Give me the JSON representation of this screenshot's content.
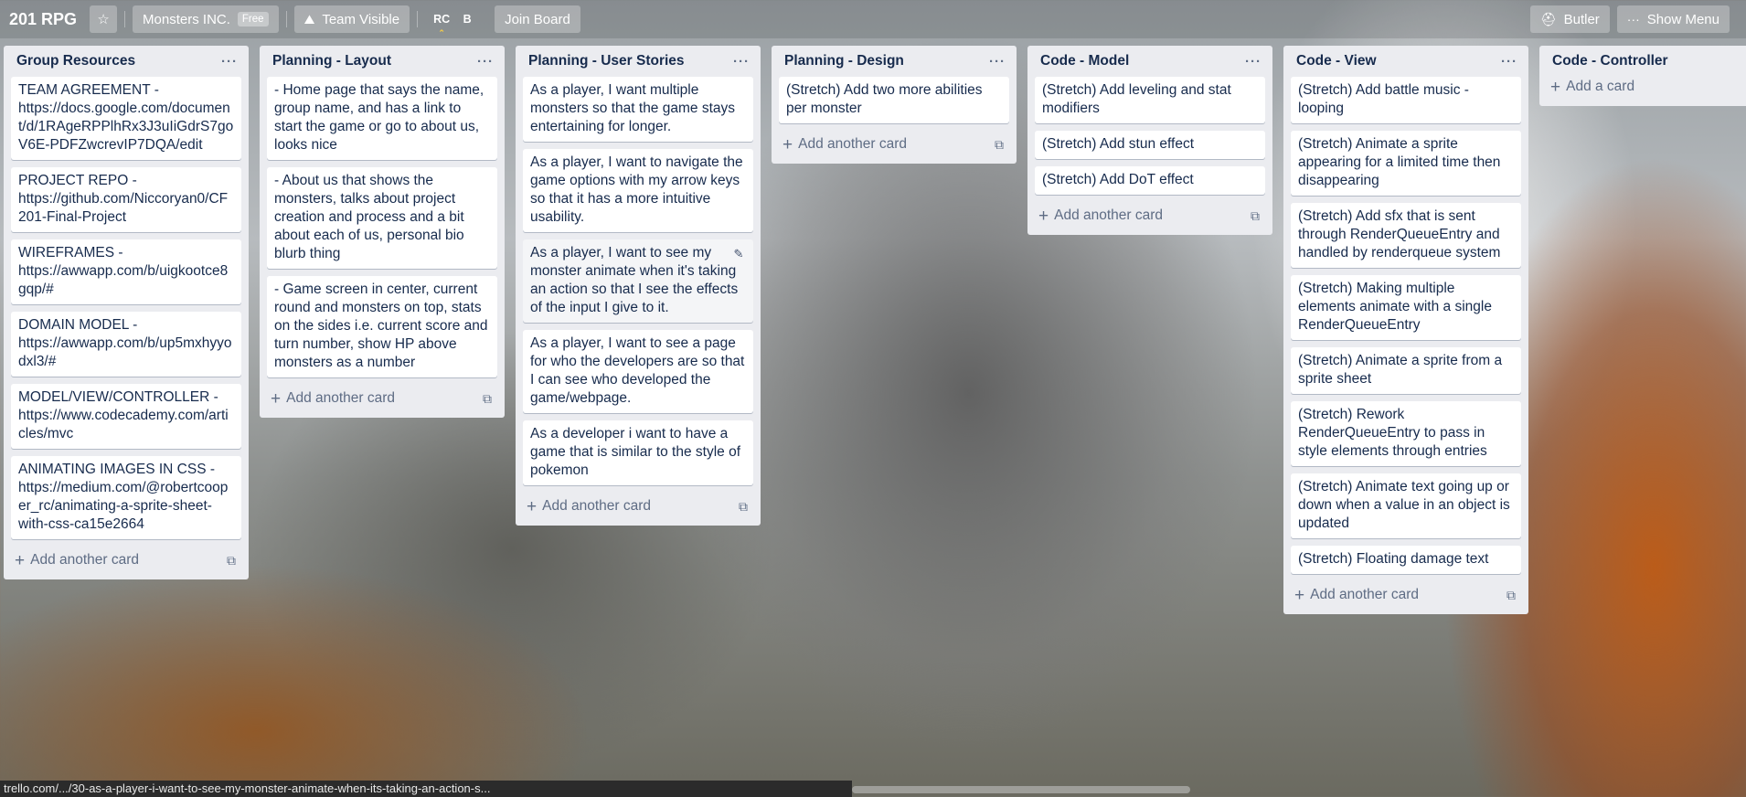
{
  "header": {
    "board_title": "201 RPG",
    "team_name": "Monsters INC.",
    "team_badge": "Free",
    "visibility": "Team Visible",
    "members": [
      "RC",
      "B"
    ],
    "join_board": "Join Board",
    "butler": "Butler",
    "show_menu": "Show Menu"
  },
  "lists": [
    {
      "title": "Group Resources",
      "cards": [
        "TEAM AGREEMENT - https://docs.google.com/document/d/1RAgeRPPlhRx3J3uIiGdrS7goV6E-PDFZwcrevIP7DQA/edit",
        "PROJECT REPO - https://github.com/Niccoryan0/CF201-Final-Project",
        "WIREFRAMES - https://awwapp.com/b/uigkootce8gqp/#",
        "DOMAIN MODEL - https://awwapp.com/b/up5mxhyyodxl3/#",
        "MODEL/VIEW/CONTROLLER - https://www.codecademy.com/articles/mvc",
        "ANIMATING IMAGES IN CSS - https://medium.com/@robertcooper_rc/animating-a-sprite-sheet-with-css-ca15e2664"
      ],
      "add_label": "Add another card"
    },
    {
      "title": "Planning - Layout",
      "cards": [
        "- Home page that says the name, group name, and has a link to start the game or go to about us, looks nice",
        "- About us that shows the monsters, talks about project creation and process and a bit about each of us, personal bio blurb thing",
        "- Game screen in center, current round and monsters on top, stats on the sides i.e. current score and turn number, show HP above monsters as a number"
      ],
      "add_label": "Add another card"
    },
    {
      "title": "Planning - User Stories",
      "cards": [
        "As a player, I want multiple monsters so that the game stays entertaining for longer.",
        "As a player, I want to navigate the game options with my arrow keys so that it has a more intuitive usability.",
        "As a player, I want to see my monster animate when it's taking an action so that I see the effects of the input I give to it.",
        "As a player, I want to see a page for who the developers are so that I can see who developed the game/webpage.",
        "As a developer i want to have a game that is similar to the style of pokemon"
      ],
      "add_label": "Add another card"
    },
    {
      "title": "Planning - Design",
      "cards": [
        "(Stretch) Add two more abilities per monster"
      ],
      "add_label": "Add another card"
    },
    {
      "title": "Code - Model",
      "cards": [
        "(Stretch) Add leveling and stat modifiers",
        "(Stretch) Add stun effect",
        "(Stretch) Add DoT effect"
      ],
      "add_label": "Add another card"
    },
    {
      "title": "Code - View",
      "cards": [
        "(Stretch) Add battle music - looping",
        "(Stretch) Animate a sprite appearing for a limited time then disappearing",
        "(Stretch) Add sfx that is sent through RenderQueueEntry and handled by renderqueue system",
        "(Stretch) Making multiple elements animate with a single RenderQueueEntry",
        "(Stretch) Animate a sprite from a sprite sheet",
        "(Stretch) Rework RenderQueueEntry to pass in style elements through entries",
        "(Stretch) Animate text going up or down when a value in an object is updated",
        "(Stretch) Floating damage text"
      ],
      "add_label": "Add another card"
    },
    {
      "title": "Code - Controller",
      "cards": [],
      "add_label": "Add a card"
    }
  ],
  "status_url": "trello.com/.../30-as-a-player-i-want-to-see-my-monster-animate-when-its-taking-an-action-s...",
  "icons": {
    "star": "star-icon",
    "visibility": "team-icon",
    "butler": "butler-icon",
    "menu": "ellipsis-icon",
    "list_menu": "ellipsis-icon",
    "add": "plus-icon",
    "template": "card-template-icon",
    "edit": "pencil-icon"
  }
}
